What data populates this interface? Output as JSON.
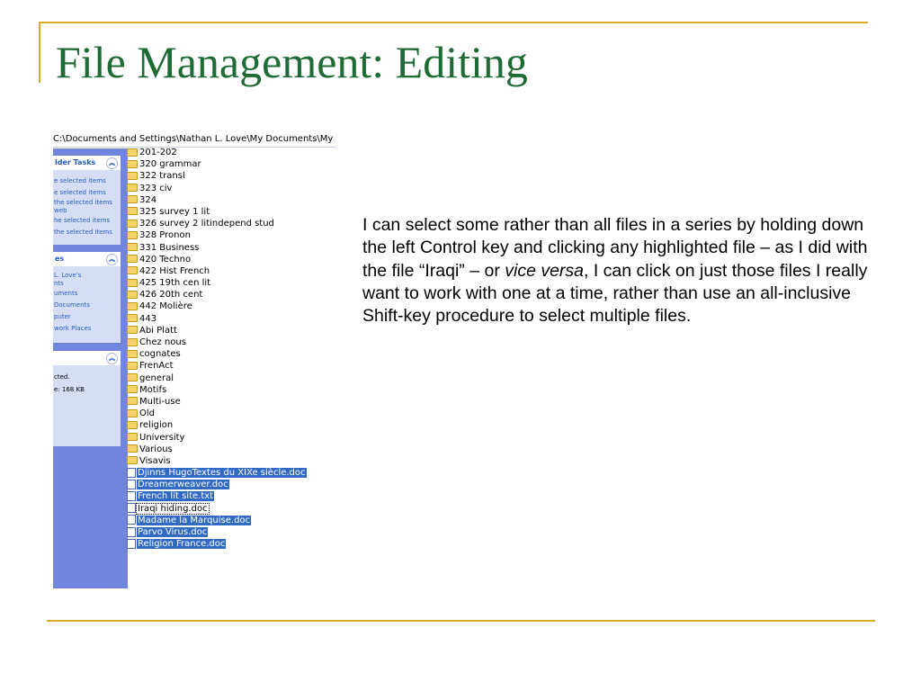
{
  "slide": {
    "title": "File Management: Editing",
    "body_before_italic": "I can select some rather than all files in a series by holding down the left Control key and clicking any highlighted file – as I did with the file “Iraqi” – or ",
    "body_italic": "vice versa",
    "body_after_italic": ", I can click on just those files I really want to work with one at a time, rather than use an all-inclusive Shift-key procedure to select multiple files."
  },
  "explorer": {
    "address": "C:\\Documents and Settings\\Nathan L. Love\\My Documents\\My Wo",
    "task_panes": [
      {
        "header": "lder Tasks",
        "items": [
          "e selected items",
          "e selected items",
          "the selected items",
          "web",
          "he selected items",
          "the selected items"
        ]
      },
      {
        "header": "es",
        "items": [
          "L. Love's",
          "nts",
          "uments",
          "Documents",
          "puter",
          "work Places"
        ]
      },
      {
        "header": "",
        "lines": [
          "cted.",
          "e: 168 KB"
        ]
      }
    ],
    "files": [
      {
        "name": "201-202",
        "kind": "folder",
        "selected": false
      },
      {
        "name": "320 grammar",
        "kind": "folder",
        "selected": false
      },
      {
        "name": "322 transl",
        "kind": "folder",
        "selected": false
      },
      {
        "name": "323 civ",
        "kind": "folder",
        "selected": false
      },
      {
        "name": "324",
        "kind": "folder",
        "selected": false
      },
      {
        "name": "325 survey 1 lit",
        "kind": "folder",
        "selected": false
      },
      {
        "name": "326 survey 2 litindepend stud",
        "kind": "folder",
        "selected": false
      },
      {
        "name": "328 Pronon",
        "kind": "folder",
        "selected": false
      },
      {
        "name": "331 Business",
        "kind": "folder",
        "selected": false
      },
      {
        "name": "420 Techno",
        "kind": "folder",
        "selected": false
      },
      {
        "name": "422 Hist French",
        "kind": "folder",
        "selected": false
      },
      {
        "name": "425 19th cen lit",
        "kind": "folder",
        "selected": false
      },
      {
        "name": "426 20th cent",
        "kind": "folder",
        "selected": false
      },
      {
        "name": "442 Molière",
        "kind": "folder",
        "selected": false
      },
      {
        "name": "443",
        "kind": "folder",
        "selected": false
      },
      {
        "name": "Abi Platt",
        "kind": "folder",
        "selected": false
      },
      {
        "name": "Chez nous",
        "kind": "folder",
        "selected": false
      },
      {
        "name": "cognates",
        "kind": "folder",
        "selected": false
      },
      {
        "name": "FrenAct",
        "kind": "folder",
        "selected": false
      },
      {
        "name": "general",
        "kind": "folder",
        "selected": false
      },
      {
        "name": "Motifs",
        "kind": "folder",
        "selected": false
      },
      {
        "name": "Multi-use",
        "kind": "folder",
        "selected": false
      },
      {
        "name": "Old",
        "kind": "folder",
        "selected": false
      },
      {
        "name": "religion",
        "kind": "folder",
        "selected": false
      },
      {
        "name": "University",
        "kind": "folder",
        "selected": false
      },
      {
        "name": "Various",
        "kind": "folder",
        "selected": false
      },
      {
        "name": "Visavis",
        "kind": "folder",
        "selected": false
      },
      {
        "name": "Djinns HugoTextes du XIXe siècle.doc",
        "kind": "doc",
        "selected": true
      },
      {
        "name": "Dreamerweaver.doc",
        "kind": "doc",
        "selected": true
      },
      {
        "name": "French lit site.txt",
        "kind": "txt",
        "selected": true
      },
      {
        "name": "Iraqi hiding.doc",
        "kind": "doc",
        "selected": false,
        "focused": true
      },
      {
        "name": "Madame la Marquise.doc",
        "kind": "doc",
        "selected": true
      },
      {
        "name": "Parvo Virus.doc",
        "kind": "doc",
        "selected": true
      },
      {
        "name": "Religion France.doc",
        "kind": "doc",
        "selected": true
      }
    ]
  },
  "colors": {
    "title": "#1f6b35",
    "rule": "#e0a829",
    "selection": "#316ac5",
    "task_pane": "#6f86dc",
    "task_box": "#d6def6",
    "task_link": "#215dc6"
  },
  "icons": {
    "folder": "folder-icon",
    "doc": "word-document-icon",
    "txt": "text-file-icon",
    "collapse": "chevron-up-icon"
  }
}
